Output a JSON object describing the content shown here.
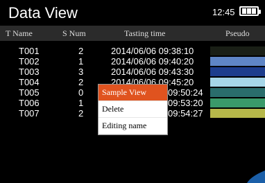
{
  "header": {
    "title": "Data View",
    "time": "12:45"
  },
  "columns": {
    "name": "T Name",
    "snum": "S Num",
    "time": "Tasting time",
    "pseudo": "Pseudo"
  },
  "rows": [
    {
      "name": "T001",
      "snum": "2",
      "time": "2014/06/06 09:38:10",
      "color": "#1a1f16"
    },
    {
      "name": "T002",
      "snum": "1",
      "time": "2014/06/06 09:40:20",
      "color": "#5f86c6"
    },
    {
      "name": "T003",
      "snum": "3",
      "time": "2014/06/06 09:43:30",
      "color": "#1d3d8d"
    },
    {
      "name": "T004",
      "snum": "2",
      "time": "2014/06/06 09:45:20",
      "color": "#a6d6e8"
    },
    {
      "name": "T005",
      "snum": "0",
      "time": "09:50:24",
      "color": "#2a6d6c"
    },
    {
      "name": "T006",
      "snum": "1",
      "time": "09:53:20",
      "color": "#3a9a6a"
    },
    {
      "name": "T007",
      "snum": "2",
      "time": "09:54:27",
      "color": "#b6b84a"
    }
  ],
  "context_menu": {
    "items": [
      "Sample View",
      "Delete",
      "Editing name"
    ]
  }
}
